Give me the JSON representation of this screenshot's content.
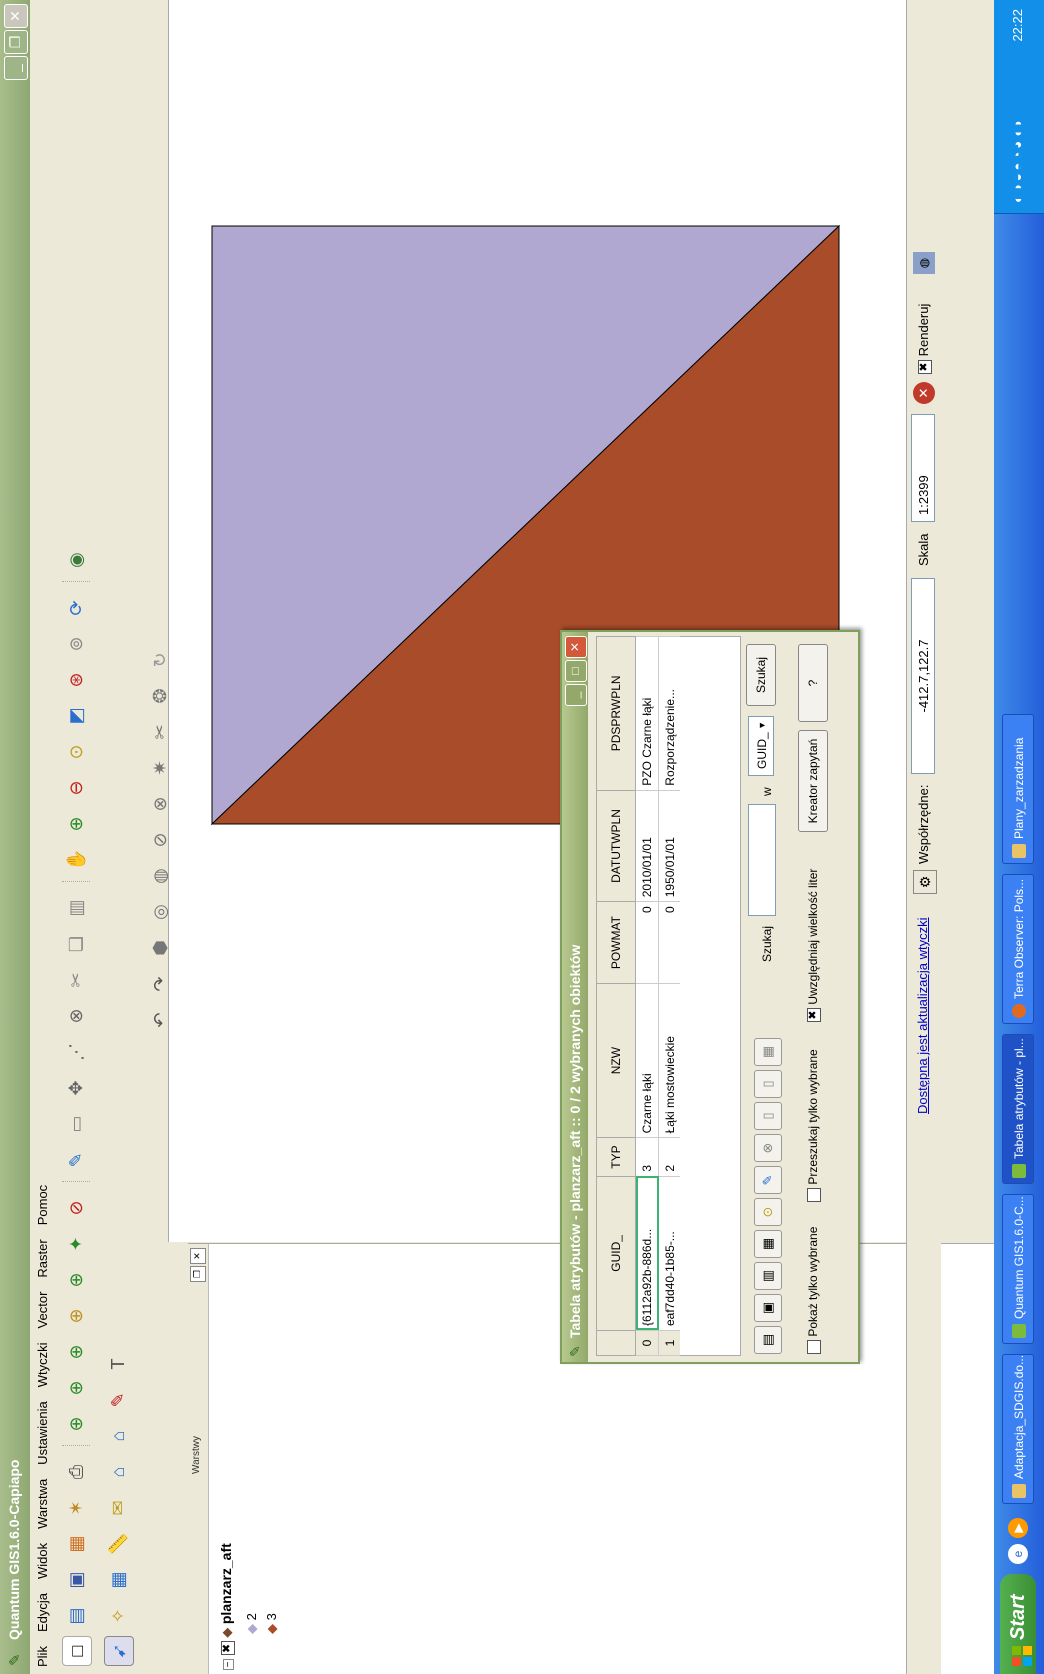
{
  "window": {
    "title": "Quantum GIS1.6.0-Capiapo"
  },
  "menu": [
    "Plik",
    "Edycja",
    "Widok",
    "Warstwa",
    "Ustawienia",
    "Wtyczki",
    "Vector",
    "Raster",
    "Pomoc"
  ],
  "layers_panel": {
    "header": "Warstwy",
    "layer_name": "planzarz_aft",
    "categories": [
      {
        "label": "2",
        "color": "#b0a8d0"
      },
      {
        "label": "3",
        "color": "#a94c2a"
      }
    ]
  },
  "map": {
    "polygon_colors": {
      "upper": "#b0a8d0",
      "lower": "#a94c2a"
    }
  },
  "attribute_table": {
    "title": "Tabela atrybutów - planzarz_aft :: 0 / 2 wybranych obiektów",
    "columns": [
      "GUID_",
      "TYP",
      "NZW",
      "POWMAT",
      "DATUTWPLN",
      "PDSPRWPLN"
    ],
    "rows": [
      [
        "0",
        "{6112a92b-886d...",
        "3",
        "Czarne łąki",
        "0",
        "2010/01/01",
        "PZO Czarne łąki"
      ],
      [
        "1",
        "eaf7dd40-1b85-...",
        "2",
        "Łąki mostowieckie",
        "0",
        "1950/01/01",
        "Rozporządzenie..."
      ]
    ],
    "search_label": "Szukaj",
    "in_label": "w",
    "field_selected": "GUID_",
    "search_button": "Szukaj",
    "show_selected_only": "Pokaż tylko wybrane",
    "search_selected_only": "Przeszukaj tylko wybrane",
    "case_sensitive": "Uwzględniaj wielkość liter",
    "query_builder": "Kreator zapytań",
    "help": "?"
  },
  "statusbar": {
    "update_link": "Dostępna jest aktualizacja wtyczki",
    "coord_label": "Współrzędne:",
    "coord_value": "-412.7,122.7",
    "scale_label": "Skala",
    "scale_value": "1:2399",
    "render_label": "Renderuj"
  },
  "taskbar": {
    "start": "Start",
    "tasks": [
      "Adaptacja_SDGIS.do...",
      "Quantum GIS1.6.0-C...",
      "Tabela atrybutów - pl...",
      "Terra Observer: Pols...",
      "Plany_zarzadzania"
    ],
    "clock": "22:22"
  }
}
